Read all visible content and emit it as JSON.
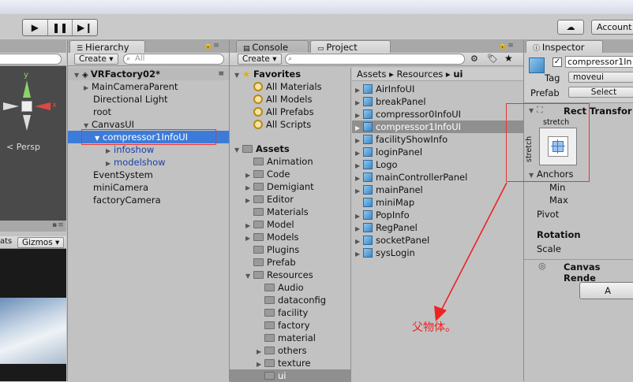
{
  "toolbar": {
    "play_icon": "play-icon",
    "pause_icon": "pause-icon",
    "step_icon": "step-icon",
    "cloud_icon": "cloud-icon",
    "account_label": "Account"
  },
  "scene": {
    "persp_label": "< Persp",
    "axis_y": "y",
    "stats_label": "ats",
    "gizmos_label": "Gizmos ▾"
  },
  "hierarchy": {
    "tab_label": "Hierarchy",
    "create_label": "Create ▾",
    "search_placeholder": "All",
    "root_label": "VRFactory02*",
    "items": [
      {
        "label": "MainCameraParent"
      },
      {
        "label": "Directional Light"
      },
      {
        "label": "root"
      },
      {
        "label": "CanvasUI"
      },
      {
        "label": "compressor1InfoUI"
      },
      {
        "label": "infoshow"
      },
      {
        "label": "modelshow"
      },
      {
        "label": "EventSystem"
      },
      {
        "label": "miniCamera"
      },
      {
        "label": "factoryCamera"
      }
    ]
  },
  "project": {
    "console_tab": "Console",
    "project_tab": "Project",
    "create_label": "Create ▾",
    "favorites_label": "Favorites",
    "favorites": [
      "All Materials",
      "All Models",
      "All Prefabs",
      "All Scripts"
    ],
    "assets_label": "Assets",
    "folders": [
      "Animation",
      "Code",
      "Demigiant",
      "Editor",
      "Materials",
      "Model",
      "Models",
      "Plugins",
      "Prefab",
      "Resources"
    ],
    "resource_folders": [
      "Audio",
      "dataconfig",
      "facility",
      "factory",
      "material",
      "others",
      "texture",
      "ui"
    ],
    "breadcrumb": [
      "Assets",
      "Resources",
      "ui"
    ],
    "files": [
      "AirInfoUI",
      "breakPanel",
      "compressor0InfoUI",
      "compressor1InfoUI",
      "facilityShowInfo",
      "loginPanel",
      "Logo",
      "mainControllerPanel",
      "mainPanel",
      "miniMap",
      "PopInfo",
      "RegPanel",
      "socketPanel",
      "sysLogin"
    ]
  },
  "inspector": {
    "tab_label": "Inspector",
    "object_name": "compressor1In",
    "tag_label": "Tag",
    "tag_value": "moveui",
    "prefab_label": "Prefab",
    "select_label": "Select",
    "rect_transform_label": "Rect Transfor",
    "stretch_top": "stretch",
    "stretch_side": "stretch",
    "anchors_label": "Anchors",
    "min_label": "Min",
    "max_label": "Max",
    "pivot_label": "Pivot",
    "rotation_label": "Rotation",
    "scale_label": "Scale",
    "canvas_renderer_label": "Canvas Rende",
    "add_button_label": "A"
  },
  "annotation": {
    "text": "父物体。",
    "color": "#e22222"
  }
}
